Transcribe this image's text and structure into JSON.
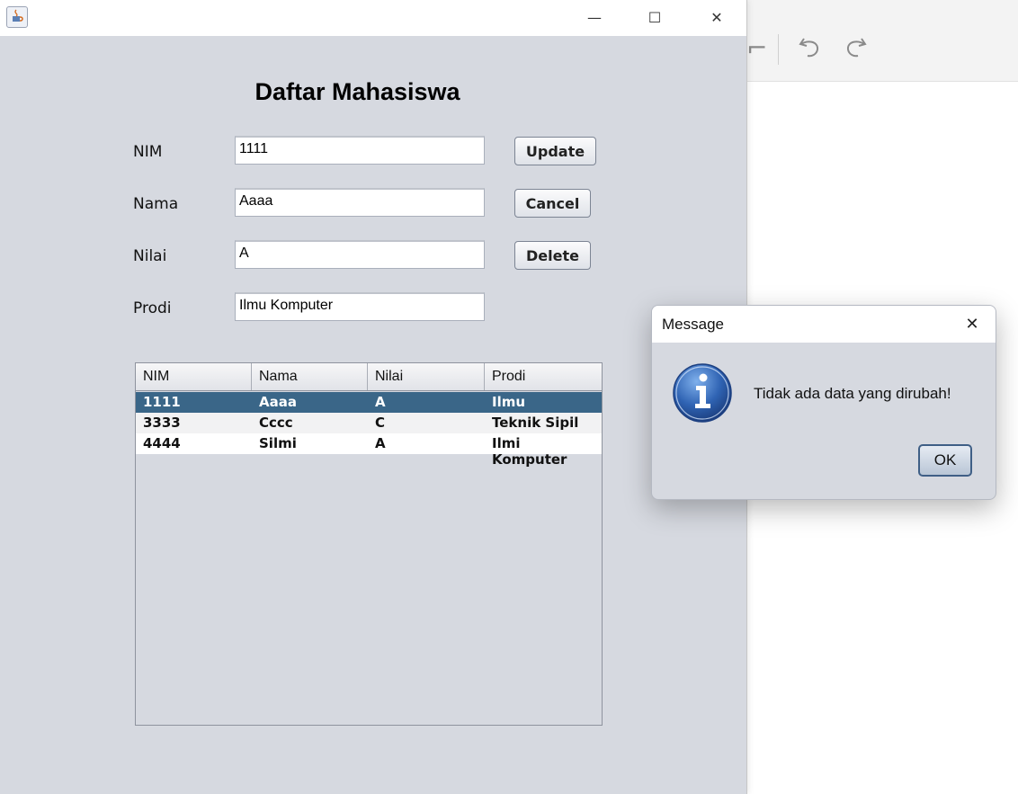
{
  "window": {
    "minimize_glyph": "—",
    "maximize_glyph": "☐",
    "close_glyph": "✕"
  },
  "form": {
    "title": "Daftar Mahasiswa",
    "fields": [
      {
        "label": "NIM",
        "value": "1111"
      },
      {
        "label": "Nama",
        "value": "Aaaa"
      },
      {
        "label": "Nilai",
        "value": "A"
      },
      {
        "label": "Prodi",
        "value": "Ilmu Komputer"
      }
    ],
    "buttons": {
      "update": "Update",
      "cancel": "Cancel",
      "delete": "Delete"
    }
  },
  "table": {
    "columns": [
      "NIM",
      "Nama",
      "Nilai",
      "Prodi"
    ],
    "rows": [
      [
        "1111",
        "Aaaa",
        "A",
        "Ilmu Komputer"
      ],
      [
        "3333",
        "Cccc",
        "C",
        "Teknik Sipil"
      ],
      [
        "4444",
        "Silmi",
        "A",
        "Ilmi Komputer"
      ]
    ],
    "selected_row": 0
  },
  "dialog": {
    "title": "Message",
    "message": "Tidak ada data yang dirubah!",
    "ok_label": "OK",
    "close_glyph": "✕",
    "icon": "info-icon"
  },
  "background_app": {
    "icons": [
      "crop-icon",
      "undo-icon",
      "redo-icon"
    ]
  },
  "colors": {
    "selected_row": "#3a6688",
    "window_bg": "#d6d9e0",
    "info_icon": "#2f63b3"
  }
}
